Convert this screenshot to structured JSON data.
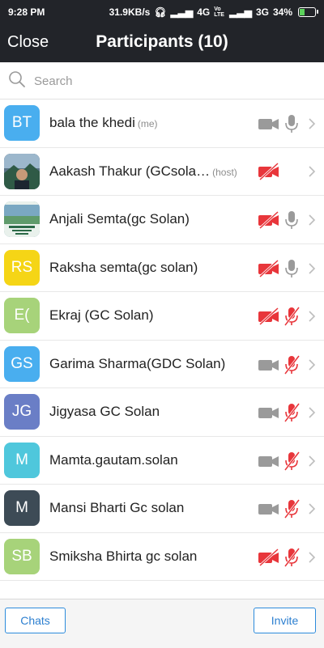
{
  "status": {
    "time": "9:28 PM",
    "speed": "31.9KB/s",
    "network1": "4G",
    "volte": "Vo LTE",
    "network2": "3G",
    "battery": "34%",
    "battery_level": 0.34
  },
  "header": {
    "close_label": "Close",
    "title": "Participants (10)"
  },
  "search": {
    "placeholder": "Search"
  },
  "participants": [
    {
      "initials": "BT",
      "name": "bala the khedi",
      "tag": "(me)",
      "avatar_color": "#49aeef",
      "video": "on",
      "mic": "on"
    },
    {
      "initials": "",
      "name": "Aakash Thakur (GCsola…",
      "tag": "(host)",
      "avatar_color": "#3d4f5c",
      "video": "off",
      "mic": "none"
    },
    {
      "initials": "",
      "name": "Anjali Semta(gc Solan)",
      "tag": "",
      "avatar_color": "#4d8a9a",
      "video": "off",
      "mic": "on"
    },
    {
      "initials": "RS",
      "name": "Raksha semta(gc solan)",
      "tag": "",
      "avatar_color": "#f5d516",
      "video": "off",
      "mic": "on"
    },
    {
      "initials": "E(",
      "name": "Ekraj (GC Solan)",
      "tag": "",
      "avatar_color": "#a7d37a",
      "video": "off",
      "mic": "off"
    },
    {
      "initials": "GS",
      "name": "Garima Sharma(GDC Solan)",
      "tag": "",
      "avatar_color": "#49aeef",
      "video": "on",
      "mic": "off"
    },
    {
      "initials": "JG",
      "name": "Jigyasa GC Solan",
      "tag": "",
      "avatar_color": "#6a7ec6",
      "video": "on",
      "mic": "off"
    },
    {
      "initials": "M",
      "name": "Mamta.gautam.solan",
      "tag": "",
      "avatar_color": "#4fc7dc",
      "video": "on",
      "mic": "off"
    },
    {
      "initials": "M",
      "name": "Mansi Bharti Gc  solan",
      "tag": "",
      "avatar_color": "#3d4b56",
      "video": "on",
      "mic": "off"
    },
    {
      "initials": "SB",
      "name": "Smiksha Bhirta gc solan",
      "tag": "",
      "avatar_color": "#a7d37a",
      "video": "off",
      "mic": "off"
    }
  ],
  "footer": {
    "chats_label": "Chats",
    "invite_label": "Invite"
  },
  "colors": {
    "header_bg": "#222429",
    "muted_red": "#e8363b",
    "icon_gray": "#9a9a9a",
    "accent_blue": "#2c8bdc"
  }
}
